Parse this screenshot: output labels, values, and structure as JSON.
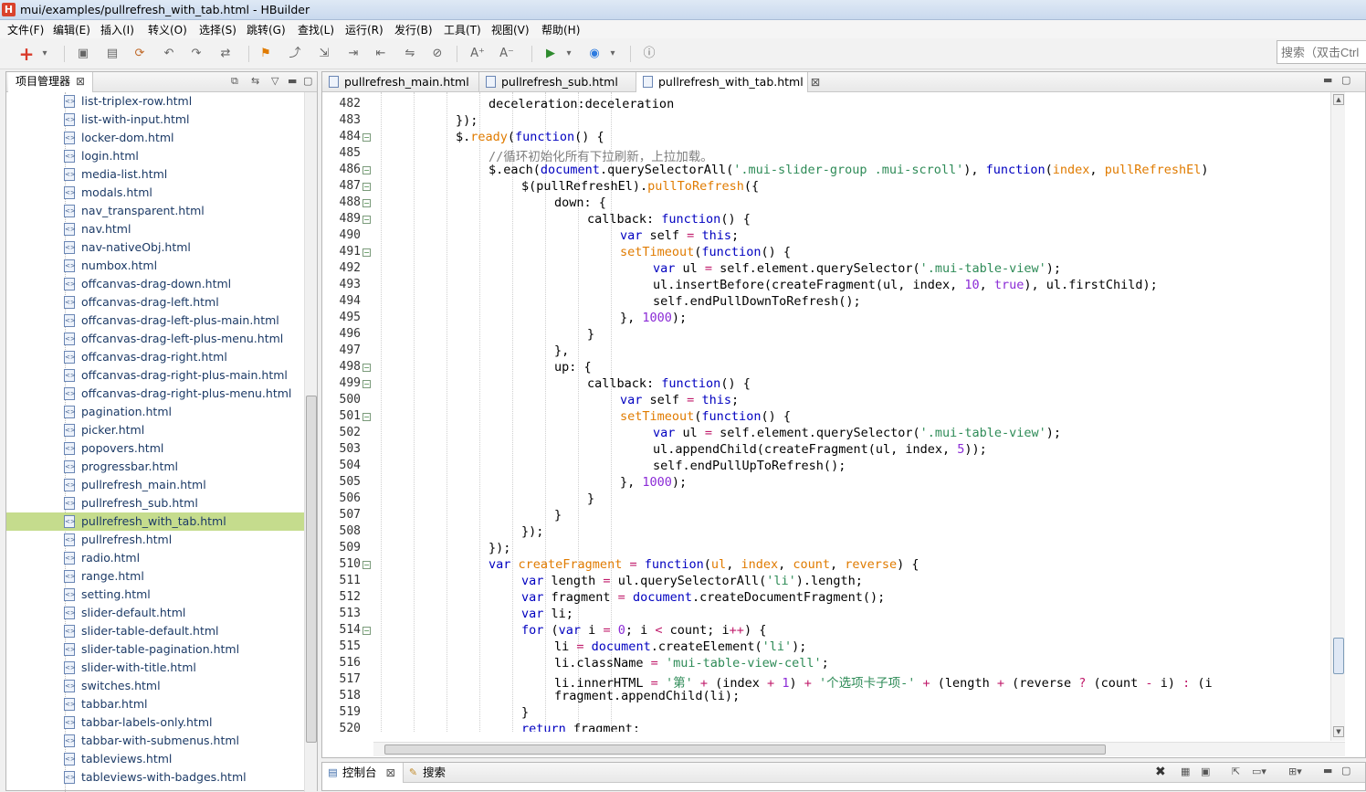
{
  "window": {
    "title": "mui/examples/pullrefresh_with_tab.html  -  HBuilder",
    "icon_letter": "H"
  },
  "menu": [
    "文件(F)",
    "编辑(E)",
    "插入(I)",
    "转义(O)",
    "选择(S)",
    "跳转(G)",
    "查找(L)",
    "运行(R)",
    "发行(B)",
    "工具(T)",
    "视图(V)",
    "帮助(H)"
  ],
  "toolbar": {
    "icons": [
      "add-icon",
      "dropdown-icon",
      "save-icon",
      "save-all-icon",
      "refresh-icon",
      "undo-icon",
      "redo-icon",
      "format-icon",
      "bookmark-icon",
      "goto-icon",
      "export-icon",
      "indent-icon",
      "outdent-icon",
      "compare-icon",
      "disabled-icon",
      "font-increase-icon",
      "font-decrease-icon",
      "run-icon",
      "dropdown-icon",
      "browser-icon",
      "dropdown-icon",
      "info-icon"
    ],
    "search_placeholder": "搜索（双击Ctrl"
  },
  "project_panel": {
    "tab_label": "项目管理器",
    "files": [
      "list-triplex-row.html",
      "list-with-input.html",
      "locker-dom.html",
      "login.html",
      "media-list.html",
      "modals.html",
      "nav_transparent.html",
      "nav.html",
      "nav-nativeObj.html",
      "numbox.html",
      "offcanvas-drag-down.html",
      "offcanvas-drag-left.html",
      "offcanvas-drag-left-plus-main.html",
      "offcanvas-drag-left-plus-menu.html",
      "offcanvas-drag-right.html",
      "offcanvas-drag-right-plus-main.html",
      "offcanvas-drag-right-plus-menu.html",
      "pagination.html",
      "picker.html",
      "popovers.html",
      "progressbar.html",
      "pullrefresh_main.html",
      "pullrefresh_sub.html",
      "pullrefresh_with_tab.html",
      "pullrefresh.html",
      "radio.html",
      "range.html",
      "setting.html",
      "slider-default.html",
      "slider-table-default.html",
      "slider-table-pagination.html",
      "slider-with-title.html",
      "switches.html",
      "tabbar.html",
      "tabbar-labels-only.html",
      "tabbar-with-submenus.html",
      "tableviews.html",
      "tableviews-with-badges.html"
    ],
    "selected": "pullrefresh_with_tab.html"
  },
  "editor": {
    "tabs": [
      "pullrefresh_main.html",
      "pullrefresh_sub.html",
      "pullrefresh_with_tab.html"
    ],
    "active_tab": "pullrefresh_with_tab.html",
    "lines": [
      {
        "n": "482",
        "fold": false,
        "ind": 3,
        "tokens": [
          [
            "",
            "deceleration:deceleration"
          ]
        ]
      },
      {
        "n": "483",
        "fold": false,
        "ind": 2,
        "tokens": [
          [
            "",
            "});"
          ]
        ]
      },
      {
        "n": "484",
        "fold": true,
        "ind": 2,
        "tokens": [
          [
            "",
            "$."
          ],
          [
            "f",
            "ready"
          ],
          [
            "",
            "("
          ],
          [
            "k",
            "function"
          ],
          [
            "",
            "() {"
          ]
        ]
      },
      {
        "n": "485",
        "fold": false,
        "ind": 3,
        "tokens": [
          [
            "c",
            "//循环初始化所有下拉刷新，上拉加载。"
          ]
        ]
      },
      {
        "n": "486",
        "fold": true,
        "ind": 3,
        "tokens": [
          [
            "",
            "$.each("
          ],
          [
            "k",
            "document"
          ],
          [
            "",
            ".querySelectorAll("
          ],
          [
            "s",
            "'.mui-slider-group .mui-scroll'"
          ],
          [
            "",
            "), "
          ],
          [
            "k",
            "function"
          ],
          [
            "",
            "("
          ],
          [
            "f",
            "index"
          ],
          [
            "",
            ", "
          ],
          [
            "f",
            "pullRefreshEl"
          ],
          [
            "",
            ")"
          ]
        ]
      },
      {
        "n": "487",
        "fold": true,
        "ind": 4,
        "tokens": [
          [
            "",
            "$(pullRefreshEl)."
          ],
          [
            "f",
            "pullToRefresh"
          ],
          [
            "",
            "({"
          ]
        ]
      },
      {
        "n": "488",
        "fold": true,
        "ind": 5,
        "tokens": [
          [
            "",
            "down: {"
          ]
        ]
      },
      {
        "n": "489",
        "fold": true,
        "ind": 6,
        "tokens": [
          [
            "",
            "callback: "
          ],
          [
            "k",
            "function"
          ],
          [
            "",
            "() {"
          ]
        ]
      },
      {
        "n": "490",
        "fold": false,
        "ind": 7,
        "tokens": [
          [
            "k",
            "var"
          ],
          [
            "",
            " self "
          ],
          [
            "o",
            "="
          ],
          [
            "",
            " "
          ],
          [
            "k",
            "this"
          ],
          [
            "",
            ";"
          ]
        ]
      },
      {
        "n": "491",
        "fold": true,
        "ind": 7,
        "tokens": [
          [
            "f",
            "setTimeout"
          ],
          [
            "",
            "("
          ],
          [
            "k",
            "function"
          ],
          [
            "",
            "() {"
          ]
        ]
      },
      {
        "n": "492",
        "fold": false,
        "ind": 8,
        "tokens": [
          [
            "k",
            "var"
          ],
          [
            "",
            " ul "
          ],
          [
            "o",
            "="
          ],
          [
            "",
            " self.element.querySelector("
          ],
          [
            "s",
            "'.mui-table-view'"
          ],
          [
            "",
            ");"
          ]
        ]
      },
      {
        "n": "493",
        "fold": false,
        "ind": 8,
        "tokens": [
          [
            "",
            "ul.insertBefore(createFragment(ul, index, "
          ],
          [
            "n",
            "10"
          ],
          [
            "",
            ", "
          ],
          [
            "n",
            "true"
          ],
          [
            "",
            "), ul.firstChild);"
          ]
        ]
      },
      {
        "n": "494",
        "fold": false,
        "ind": 8,
        "tokens": [
          [
            "",
            "self.endPullDownToRefresh();"
          ]
        ]
      },
      {
        "n": "495",
        "fold": false,
        "ind": 7,
        "tokens": [
          [
            "",
            "}, "
          ],
          [
            "n",
            "1000"
          ],
          [
            "",
            ");"
          ]
        ]
      },
      {
        "n": "496",
        "fold": false,
        "ind": 6,
        "tokens": [
          [
            "",
            "}"
          ]
        ]
      },
      {
        "n": "497",
        "fold": false,
        "ind": 5,
        "tokens": [
          [
            "",
            "},"
          ]
        ]
      },
      {
        "n": "498",
        "fold": true,
        "ind": 5,
        "tokens": [
          [
            "",
            "up: {"
          ]
        ]
      },
      {
        "n": "499",
        "fold": true,
        "ind": 6,
        "tokens": [
          [
            "",
            "callback: "
          ],
          [
            "k",
            "function"
          ],
          [
            "",
            "() {"
          ]
        ]
      },
      {
        "n": "500",
        "fold": false,
        "ind": 7,
        "tokens": [
          [
            "k",
            "var"
          ],
          [
            "",
            " self "
          ],
          [
            "o",
            "="
          ],
          [
            "",
            " "
          ],
          [
            "k",
            "this"
          ],
          [
            "",
            ";"
          ]
        ]
      },
      {
        "n": "501",
        "fold": true,
        "ind": 7,
        "tokens": [
          [
            "f",
            "setTimeout"
          ],
          [
            "",
            "("
          ],
          [
            "k",
            "function"
          ],
          [
            "",
            "() {"
          ]
        ]
      },
      {
        "n": "502",
        "fold": false,
        "ind": 8,
        "tokens": [
          [
            "k",
            "var"
          ],
          [
            "",
            " ul "
          ],
          [
            "o",
            "="
          ],
          [
            "",
            " self.element.querySelector("
          ],
          [
            "s",
            "'.mui-table-view'"
          ],
          [
            "",
            ");"
          ]
        ]
      },
      {
        "n": "503",
        "fold": false,
        "ind": 8,
        "tokens": [
          [
            "",
            "ul.appendChild(createFragment(ul, index, "
          ],
          [
            "n",
            "5"
          ],
          [
            "",
            "));"
          ]
        ]
      },
      {
        "n": "504",
        "fold": false,
        "ind": 8,
        "tokens": [
          [
            "",
            "self.endPullUpToRefresh();"
          ]
        ]
      },
      {
        "n": "505",
        "fold": false,
        "ind": 7,
        "tokens": [
          [
            "",
            "}, "
          ],
          [
            "n",
            "1000"
          ],
          [
            "",
            ");"
          ]
        ]
      },
      {
        "n": "506",
        "fold": false,
        "ind": 6,
        "tokens": [
          [
            "",
            "}"
          ]
        ]
      },
      {
        "n": "507",
        "fold": false,
        "ind": 5,
        "tokens": [
          [
            "",
            "}"
          ]
        ]
      },
      {
        "n": "508",
        "fold": false,
        "ind": 4,
        "tokens": [
          [
            "",
            "});"
          ]
        ]
      },
      {
        "n": "509",
        "fold": false,
        "ind": 3,
        "tokens": [
          [
            "",
            "});"
          ]
        ]
      },
      {
        "n": "510",
        "fold": true,
        "ind": 3,
        "tokens": [
          [
            "k",
            "var"
          ],
          [
            "",
            " "
          ],
          [
            "f",
            "createFragment"
          ],
          [
            "",
            " "
          ],
          [
            "o",
            "="
          ],
          [
            "",
            " "
          ],
          [
            "k",
            "function"
          ],
          [
            "",
            "("
          ],
          [
            "f",
            "ul"
          ],
          [
            "",
            ", "
          ],
          [
            "f",
            "index"
          ],
          [
            "",
            ", "
          ],
          [
            "f",
            "count"
          ],
          [
            "",
            ", "
          ],
          [
            "f",
            "reverse"
          ],
          [
            "",
            ") {"
          ]
        ]
      },
      {
        "n": "511",
        "fold": false,
        "ind": 4,
        "tokens": [
          [
            "k",
            "var"
          ],
          [
            "",
            " length "
          ],
          [
            "o",
            "="
          ],
          [
            "",
            " ul.querySelectorAll("
          ],
          [
            "s",
            "'li'"
          ],
          [
            "",
            ").length;"
          ]
        ]
      },
      {
        "n": "512",
        "fold": false,
        "ind": 4,
        "tokens": [
          [
            "k",
            "var"
          ],
          [
            "",
            " fragment "
          ],
          [
            "o",
            "="
          ],
          [
            "",
            " "
          ],
          [
            "k",
            "document"
          ],
          [
            "",
            ".createDocumentFragment();"
          ]
        ]
      },
      {
        "n": "513",
        "fold": false,
        "ind": 4,
        "tokens": [
          [
            "k",
            "var"
          ],
          [
            "",
            " li;"
          ]
        ]
      },
      {
        "n": "514",
        "fold": true,
        "ind": 4,
        "tokens": [
          [
            "k",
            "for"
          ],
          [
            "",
            " ("
          ],
          [
            "k",
            "var"
          ],
          [
            "",
            " i "
          ],
          [
            "o",
            "="
          ],
          [
            "",
            " "
          ],
          [
            "n",
            "0"
          ],
          [
            "",
            "; i "
          ],
          [
            "o",
            "<"
          ],
          [
            "",
            " count; i"
          ],
          [
            "o",
            "++"
          ],
          [
            "",
            ") {"
          ]
        ]
      },
      {
        "n": "515",
        "fold": false,
        "ind": 5,
        "tokens": [
          [
            "",
            "li "
          ],
          [
            "o",
            "="
          ],
          [
            "",
            " "
          ],
          [
            "k",
            "document"
          ],
          [
            "",
            ".createElement("
          ],
          [
            "s",
            "'li'"
          ],
          [
            "",
            ");"
          ]
        ]
      },
      {
        "n": "516",
        "fold": false,
        "ind": 5,
        "tokens": [
          [
            "",
            "li.className "
          ],
          [
            "o",
            "="
          ],
          [
            "",
            " "
          ],
          [
            "s",
            "'mui-table-view-cell'"
          ],
          [
            "",
            ";"
          ]
        ]
      },
      {
        "n": "517",
        "fold": false,
        "ind": 5,
        "tokens": [
          [
            "",
            "li.innerHTML "
          ],
          [
            "o",
            "="
          ],
          [
            "",
            " "
          ],
          [
            "s",
            "'第'"
          ],
          [
            "",
            " "
          ],
          [
            "o",
            "+"
          ],
          [
            "",
            " (index "
          ],
          [
            "o",
            "+"
          ],
          [
            "",
            " "
          ],
          [
            "n",
            "1"
          ],
          [
            "",
            ") "
          ],
          [
            "o",
            "+"
          ],
          [
            "",
            " "
          ],
          [
            "s",
            "'个选项卡子项-'"
          ],
          [
            "",
            " "
          ],
          [
            "o",
            "+"
          ],
          [
            "",
            " (length "
          ],
          [
            "o",
            "+"
          ],
          [
            "",
            " (reverse "
          ],
          [
            "o",
            "?"
          ],
          [
            "",
            " (count "
          ],
          [
            "o",
            "-"
          ],
          [
            "",
            " i) "
          ],
          [
            "o",
            ":"
          ],
          [
            "",
            " (i"
          ]
        ]
      },
      {
        "n": "518",
        "fold": false,
        "ind": 5,
        "tokens": [
          [
            "",
            "fragment.appendChild(li);"
          ]
        ]
      },
      {
        "n": "519",
        "fold": false,
        "ind": 4,
        "tokens": [
          [
            "",
            "}"
          ]
        ]
      },
      {
        "n": "520",
        "fold": false,
        "ind": 4,
        "tokens": [
          [
            "k",
            "return"
          ],
          [
            "",
            " fragment;"
          ]
        ]
      }
    ]
  },
  "console": {
    "tabs": [
      "控制台",
      "搜索"
    ],
    "active_tab": "控制台"
  },
  "colors": {
    "selection": "#c5dc8d",
    "keyword": "#0000c0",
    "string": "#2e8b57",
    "number": "#8b2bd6",
    "comment": "#7f7f7f"
  }
}
